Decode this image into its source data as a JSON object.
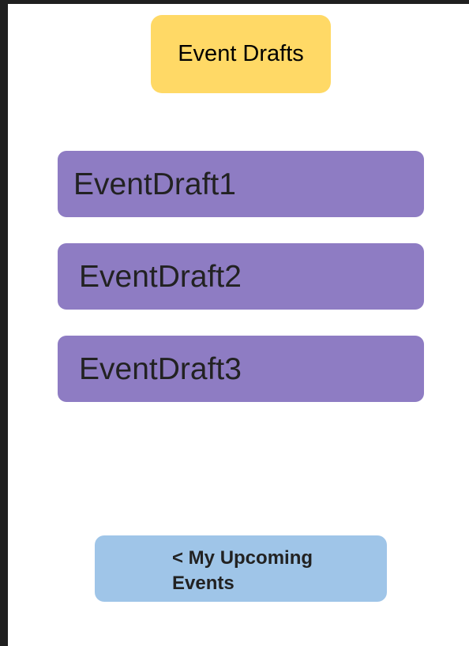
{
  "header": {
    "title": "Event Drafts"
  },
  "drafts": [
    {
      "label": "EventDraft1"
    },
    {
      "label": "EventDraft2"
    },
    {
      "label": "EventDraft3"
    }
  ],
  "navigation": {
    "back_label": "< My Upcoming Events"
  },
  "colors": {
    "page_background": "#ffffff",
    "outer_background": "#1f1f1f",
    "title_badge": "#ffd966",
    "draft_item": "#8e7cc3",
    "nav_button": "#9fc5e8"
  }
}
